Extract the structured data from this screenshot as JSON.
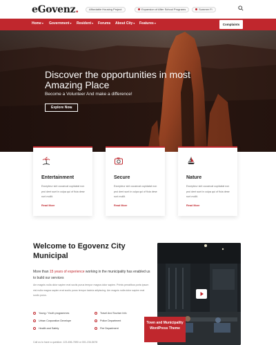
{
  "brand": {
    "name": "eGovenz",
    "dot": ".",
    "accent": "#c0272d"
  },
  "topbar": {
    "chips": [
      "Affordable Housing Project",
      "Expansion of After School Programs",
      "Summer Fi"
    ],
    "search_icon": "search-icon"
  },
  "nav": {
    "items": [
      "Home",
      "Government",
      "Resident",
      "Forums",
      "About City",
      "Features"
    ],
    "complaints_label": "Complaints"
  },
  "hero": {
    "title": "Discover the opportunities in most Amazing Place",
    "subtitle": "Become a Volunteer And make a difference!",
    "button_label": "Explore Now",
    "button_arrow": "→"
  },
  "cards": [
    {
      "icon": "palm-island-icon",
      "title": "Entertainment",
      "text": "Excepteur sint occaecat cupidatat non proi dent sunt in culpa qui of ficia dese runt mollit.",
      "link": "Read More"
    },
    {
      "icon": "camera-icon",
      "title": "Secure",
      "text": "Excepteur sint occaecat cupidatat non proi dent sunt in culpa qui of ficia dese runt mollit.",
      "link": "Read More"
    },
    {
      "icon": "sailboat-icon",
      "title": "Nature",
      "text": "Excepteur sint occaecat cupidatat non proi dent sunt in culpa qui of ficia dese runt mollit.",
      "link": "Read More"
    }
  ],
  "welcome": {
    "title": "Welcome to Egovenz City Municipal",
    "lead_before": "More than ",
    "lead_highlight": "15 years of experience",
    "lead_after": " working in the municipality has enabled us to build our services",
    "body": "Am magnis nulla dolor sapien erat sociis purus tempor magna dolor sapien. Primis penatibus porta ipsum nisl nulla magna sapien erat sociis purus tempor lacinia adipiscing. Am magnis nulla dolor sapien erat sociis purus.",
    "services": [
      "Young / Youth programmes",
      "Travel And Tourism Info",
      "Urban Corporation Develope",
      "Police Department",
      "Health and Safety",
      "Fire Department"
    ],
    "contact": "Call us to have a question: 123-456-7890 or 001-234-5678"
  },
  "office": {
    "play_icon": "play-icon",
    "badge": "Town and Municipality WordPress Theme"
  }
}
